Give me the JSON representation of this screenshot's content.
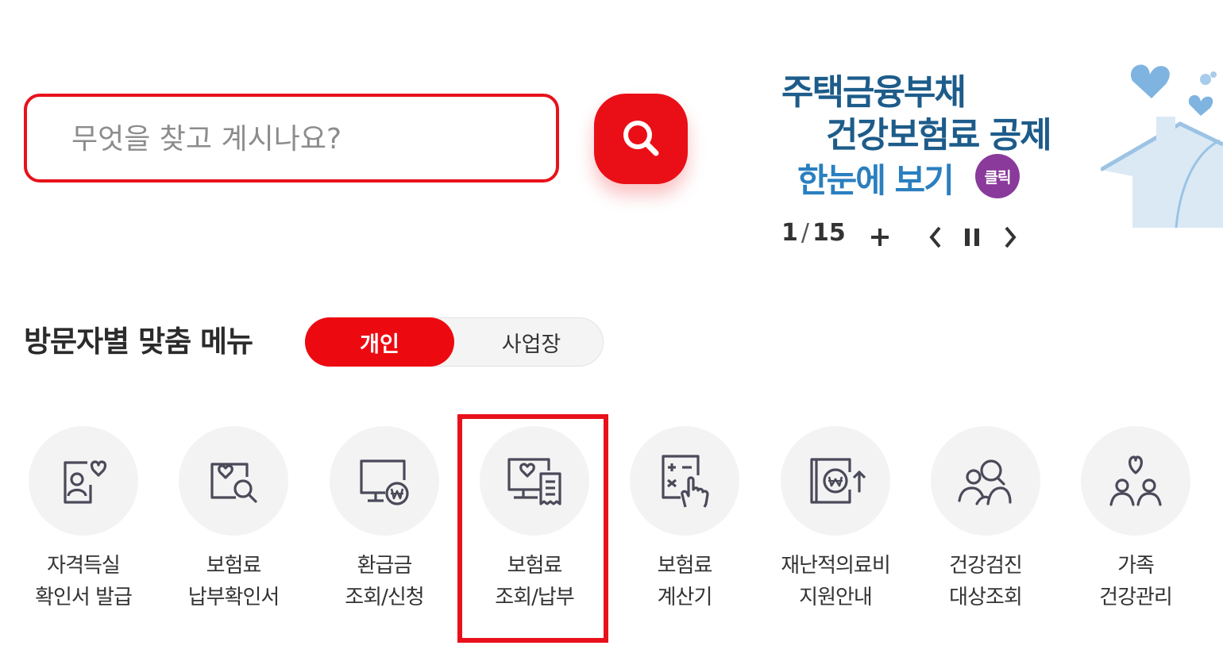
{
  "search": {
    "placeholder": "무엇을 찾고 계시나요?"
  },
  "banner": {
    "line1": "주택금융부채",
    "line2": "건강보험료 공제",
    "line3": "한눈에 보기",
    "badge": "클릭",
    "counter_current": "1",
    "counter_separator": "/",
    "counter_total": "15"
  },
  "section": {
    "title": "방문자별 맞춤 메뉴",
    "toggle_personal": "개인",
    "toggle_business": "사업장"
  },
  "menu": [
    {
      "line1": "자격득실",
      "line2": "확인서 발급",
      "icon": "certificate-icon"
    },
    {
      "line1": "보험료",
      "line2": "납부확인서",
      "icon": "payment-confirmation-icon"
    },
    {
      "line1": "환급금",
      "line2": "조회/신청",
      "icon": "refund-icon"
    },
    {
      "line1": "보험료",
      "line2": "조회/납부",
      "icon": "premium-inquiry-icon"
    },
    {
      "line1": "보험료",
      "line2": "계산기",
      "icon": "calculator-icon"
    },
    {
      "line1": "재난적의료비",
      "line2": "지원안내",
      "icon": "medical-support-icon"
    },
    {
      "line1": "건강검진",
      "line2": "대상조회",
      "icon": "health-checkup-icon"
    },
    {
      "line1": "가족",
      "line2": "건강관리",
      "icon": "family-health-icon"
    }
  ],
  "colors": {
    "accent": "#ea0f17",
    "banner_text": "#1d5c8a",
    "icon_stroke": "#4a4a5a"
  }
}
